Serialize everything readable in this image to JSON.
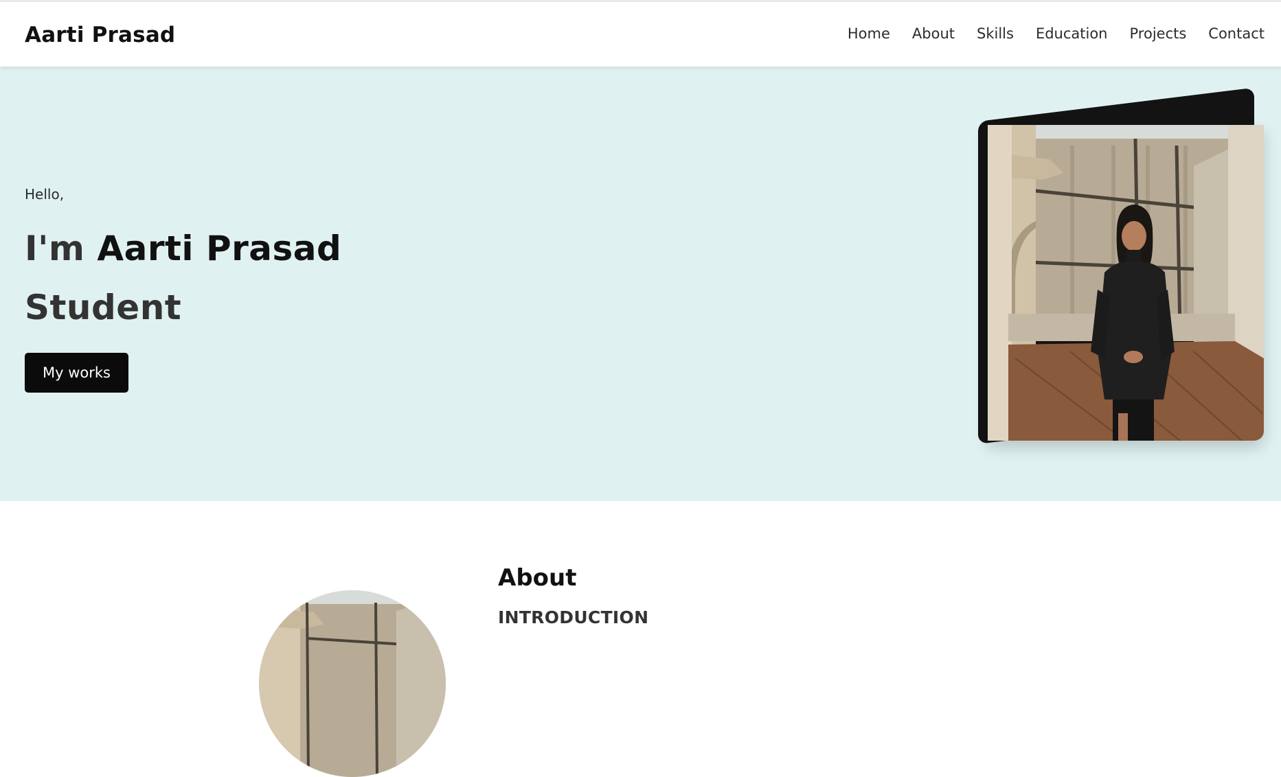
{
  "site": {
    "logo": "Aarti Prasad"
  },
  "nav": {
    "items": [
      {
        "label": "Home"
      },
      {
        "label": "About"
      },
      {
        "label": "Skills"
      },
      {
        "label": "Education"
      },
      {
        "label": "Projects"
      },
      {
        "label": "Contact"
      }
    ]
  },
  "hero": {
    "greeting": "Hello,",
    "prefix": "I'm ",
    "name": "Aarti Prasad",
    "role": "Student",
    "button_label": "My works",
    "background_color": "#e0f1f1"
  },
  "about": {
    "title": "About",
    "subtitle": "INTRODUCTION"
  },
  "colors": {
    "text_dark": "#111111",
    "button_bg": "#0b0b0b",
    "button_text": "#ffffff"
  }
}
